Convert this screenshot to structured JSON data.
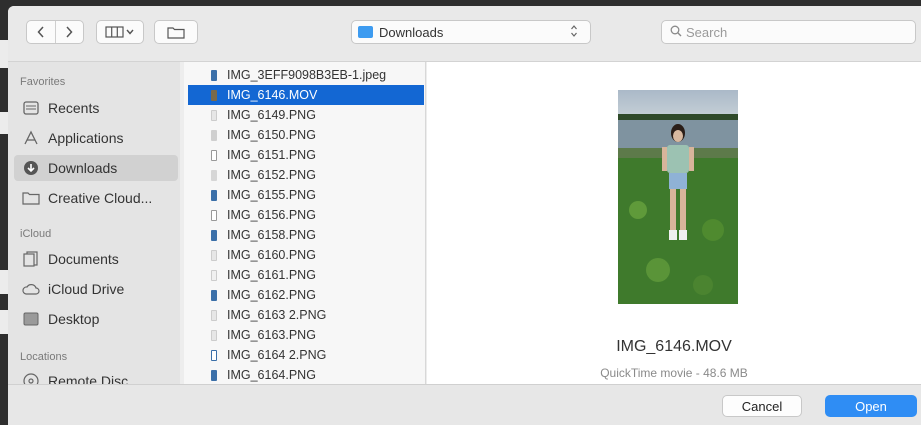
{
  "toolbar": {
    "back_icon": "chevron-left-icon",
    "forward_icon": "chevron-right-icon",
    "view_icon": "column-view-icon",
    "folder_icon": "new-folder-icon",
    "location": "Downloads",
    "location_stepper": "⌃⌄",
    "search_placeholder": "Search"
  },
  "sidebar": {
    "sections": {
      "favorites": "Favorites",
      "icloud": "iCloud",
      "locations": "Locations"
    },
    "items": [
      {
        "label": "Recents",
        "icon": "recents-icon"
      },
      {
        "label": "Applications",
        "icon": "applications-icon"
      },
      {
        "label": "Downloads",
        "icon": "downloads-icon",
        "selected": true
      },
      {
        "label": "Creative Cloud...",
        "icon": "folder-icon"
      },
      {
        "label": "Documents",
        "icon": "documents-icon"
      },
      {
        "label": "iCloud Drive",
        "icon": "cloud-icon"
      },
      {
        "label": "Desktop",
        "icon": "desktop-icon"
      },
      {
        "label": "Remote Disc",
        "icon": "disc-icon"
      }
    ]
  },
  "files": [
    {
      "name": "IMG_3EFF9098B3EB-1.jpeg"
    },
    {
      "name": "IMG_6146.MOV",
      "selected": true
    },
    {
      "name": "IMG_6149.PNG"
    },
    {
      "name": "IMG_6150.PNG"
    },
    {
      "name": "IMG_6151.PNG"
    },
    {
      "name": "IMG_6152.PNG"
    },
    {
      "name": "IMG_6155.PNG"
    },
    {
      "name": "IMG_6156.PNG"
    },
    {
      "name": "IMG_6158.PNG"
    },
    {
      "name": "IMG_6160.PNG"
    },
    {
      "name": "IMG_6161.PNG"
    },
    {
      "name": "IMG_6162.PNG"
    },
    {
      "name": "IMG_6163 2.PNG"
    },
    {
      "name": "IMG_6163.PNG"
    },
    {
      "name": "IMG_6164 2.PNG"
    },
    {
      "name": "IMG_6164.PNG"
    }
  ],
  "preview": {
    "name": "IMG_6146.MOV",
    "kind": "QuickTime movie - 48.6 MB"
  },
  "footer": {
    "cancel": "Cancel",
    "open": "Open"
  },
  "colors": {
    "accent": "#1367d3",
    "open_button": "#2f8df4",
    "selection_sidebar": "#d1d1d1"
  }
}
